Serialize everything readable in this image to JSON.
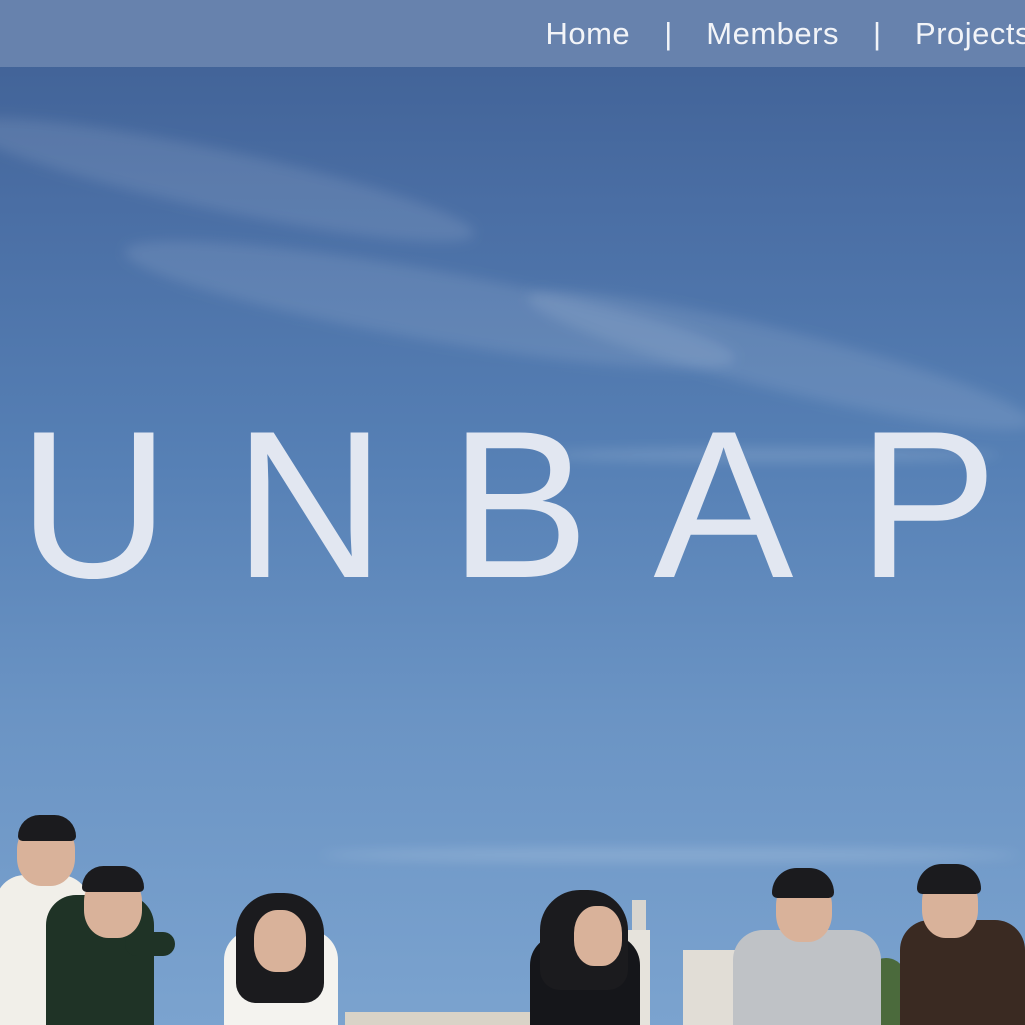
{
  "nav": {
    "items": [
      {
        "label": "Home"
      },
      {
        "label": "Members"
      },
      {
        "label": "Projects"
      }
    ],
    "separator": "|"
  },
  "hero": {
    "title": "UNBAP"
  },
  "colors": {
    "nav_background": "#6782ad",
    "sky_top": "#3f5f93",
    "sky_bottom": "#7ba3cf",
    "title_text": "#e2e7f1"
  },
  "photo": {
    "subject": "group-of-six-students-posing"
  }
}
